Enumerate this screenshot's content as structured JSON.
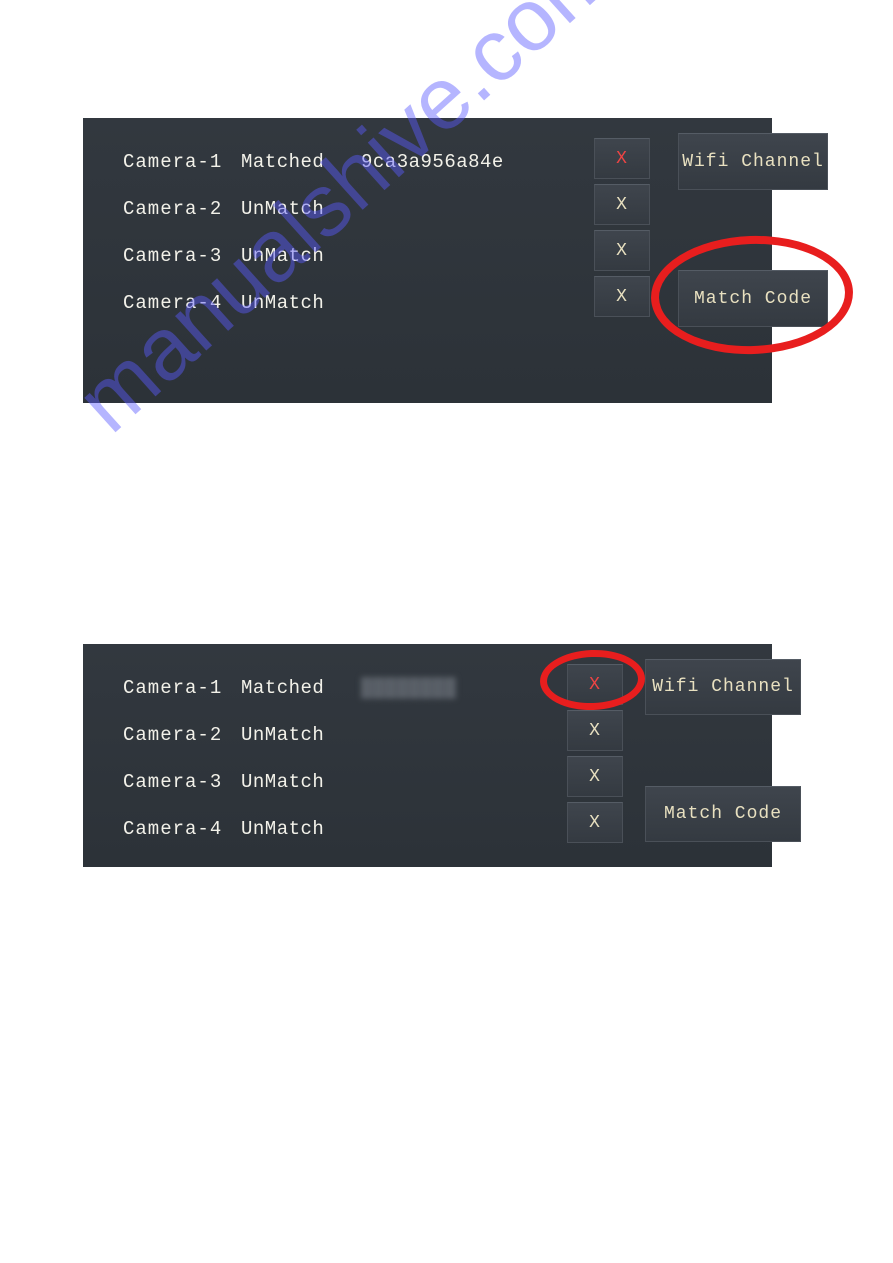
{
  "watermark": "manualshive.com",
  "panel1": {
    "cameras": [
      {
        "name": "Camera-1",
        "status": "Matched",
        "id": "9ca3a956a84e"
      },
      {
        "name": "Camera-2",
        "status": "UnMatch",
        "id": ""
      },
      {
        "name": "Camera-3",
        "status": "UnMatch",
        "id": ""
      },
      {
        "name": "Camera-4",
        "status": "UnMatch",
        "id": ""
      }
    ],
    "x_labels": [
      "X",
      "X",
      "X",
      "X"
    ],
    "wifi_label": "Wifi Channel",
    "match_label": "Match Code"
  },
  "panel2": {
    "cameras": [
      {
        "name": "Camera-1",
        "status": "Matched",
        "id": "████████"
      },
      {
        "name": "Camera-2",
        "status": "UnMatch",
        "id": ""
      },
      {
        "name": "Camera-3",
        "status": "UnMatch",
        "id": ""
      },
      {
        "name": "Camera-4",
        "status": "UnMatch",
        "id": ""
      }
    ],
    "x_labels": [
      "X",
      "X",
      "X",
      "X"
    ],
    "wifi_label": "Wifi Channel",
    "match_label": "Match Code"
  }
}
